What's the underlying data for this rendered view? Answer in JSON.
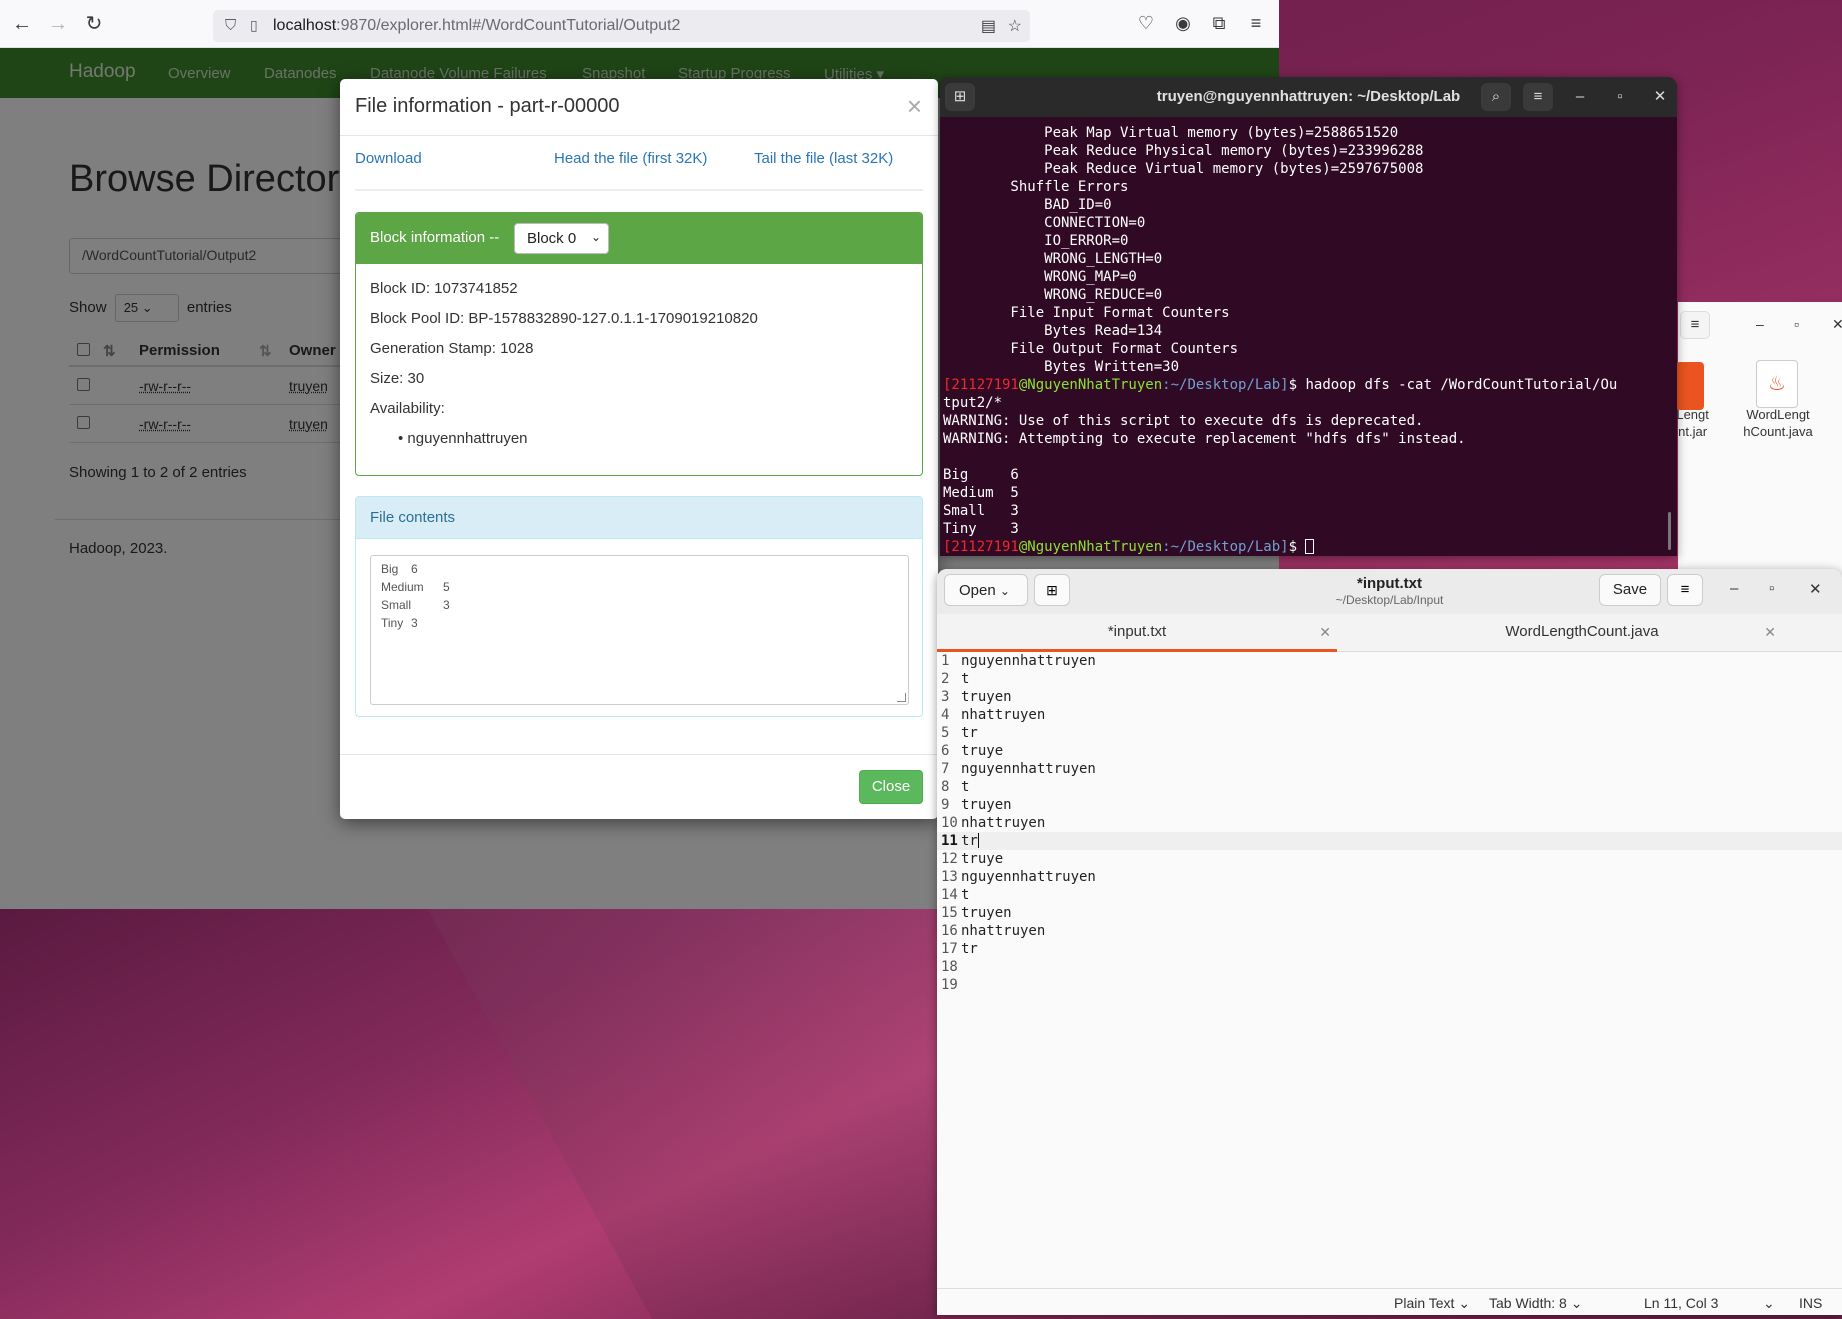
{
  "browser": {
    "url_prefix": "localhost",
    "url_rest": ":9870/explorer.html#/WordCountTutorial/Output2",
    "nav": {
      "brand": "Hadoop",
      "links": [
        "Overview",
        "Datanodes",
        "Datanode Volume Failures",
        "Snapshot",
        "Startup Progress",
        "Utilities ▾"
      ]
    },
    "page": {
      "title": "Browse Directory",
      "path_value": "/WordCountTutorial/Output2",
      "show_label": "Show",
      "show_value": "25",
      "entries_label": "entries",
      "columns": [
        "Permission",
        "Owner"
      ],
      "rows": [
        {
          "permission": "-rw-r--r--",
          "owner": "truyen"
        },
        {
          "permission": "-rw-r--r--",
          "owner": "truyen"
        }
      ],
      "showing_text": "Showing 1 to 2 of 2 entries",
      "footer": "Hadoop, 2023."
    }
  },
  "modal": {
    "title": "File information - part-r-00000",
    "close_symbol": "×",
    "links": {
      "download": "Download",
      "head": "Head the file (first 32K)",
      "tail": "Tail the file (last 32K)"
    },
    "block_label": "Block information --",
    "block_select": "Block 0",
    "block_id": "Block ID: 1073741852",
    "block_pool": "Block Pool ID: BP-1578832890-127.0.1.1-1709019210820",
    "generation_stamp": "Generation Stamp: 1028",
    "size": "Size: 30",
    "availability_label": "Availability:",
    "availability_node": "nguyennhattruyen",
    "file_contents_label": "File contents",
    "file_lines": [
      {
        "word": "Big",
        "count": "6"
      },
      {
        "word": "Medium",
        "count": "5"
      },
      {
        "word": "Small",
        "count": "3"
      },
      {
        "word": "Tiny",
        "count": "3"
      }
    ],
    "close_label": "Close"
  },
  "terminal": {
    "title": "truyen@nguyennhattruyen: ~/Desktop/Lab",
    "lines": [
      "            Peak Map Virtual memory (bytes)=2588651520",
      "            Peak Reduce Physical memory (bytes)=233996288",
      "            Peak Reduce Virtual memory (bytes)=2597675008",
      "        Shuffle Errors",
      "            BAD_ID=0",
      "            CONNECTION=0",
      "            IO_ERROR=0",
      "            WRONG_LENGTH=0",
      "            WRONG_MAP=0",
      "            WRONG_REDUCE=0",
      "        File Input Format Counters",
      "            Bytes Read=134",
      "        File Output Format Counters",
      "            Bytes Written=30"
    ],
    "prompt": {
      "user": "[21127191",
      "host": "@NguyenNhatTruyen",
      "dir": ":~/Desktop/Lab]",
      "symbol": "$"
    },
    "command": " hadoop dfs -cat /WordCountTutorial/Ou",
    "command_wrap": "tput2/*",
    "output": [
      "WARNING: Use of this script to execute dfs is deprecated.",
      "WARNING: Attempting to execute replacement \"hdfs dfs\" instead.",
      "",
      "Big     6",
      "Medium  5",
      "Small   3",
      "Tiny    3"
    ]
  },
  "file_manager": {
    "item1_label": "dLengt\nunt.jar",
    "item2_label": "WordLengt\nhCount.java"
  },
  "editor": {
    "open_label": "Open",
    "title": "*input.txt",
    "subtitle": "~/Desktop/Lab/Input",
    "save_label": "Save",
    "tabs": [
      "*input.txt",
      "WordLengthCount.java"
    ],
    "lines": [
      "nguyennhattruyen",
      "t",
      "truyen",
      "nhattruyen",
      "tr",
      "truye",
      "nguyennhattruyen",
      "t",
      "truyen",
      "nhattruyen",
      "tr",
      "truye",
      "nguyennhattruyen",
      "t",
      "truyen",
      "nhattruyen",
      "tr",
      "",
      ""
    ],
    "current_line": 11,
    "status": {
      "language": "Plain Text",
      "tab_width": "Tab Width: 8",
      "position": "Ln 11, Col 3",
      "mode": "INS"
    }
  },
  "colors": {
    "hadoop_green": "#3f8a2c",
    "accent_orange": "#e95420",
    "terminal_bg": "#300a24"
  }
}
